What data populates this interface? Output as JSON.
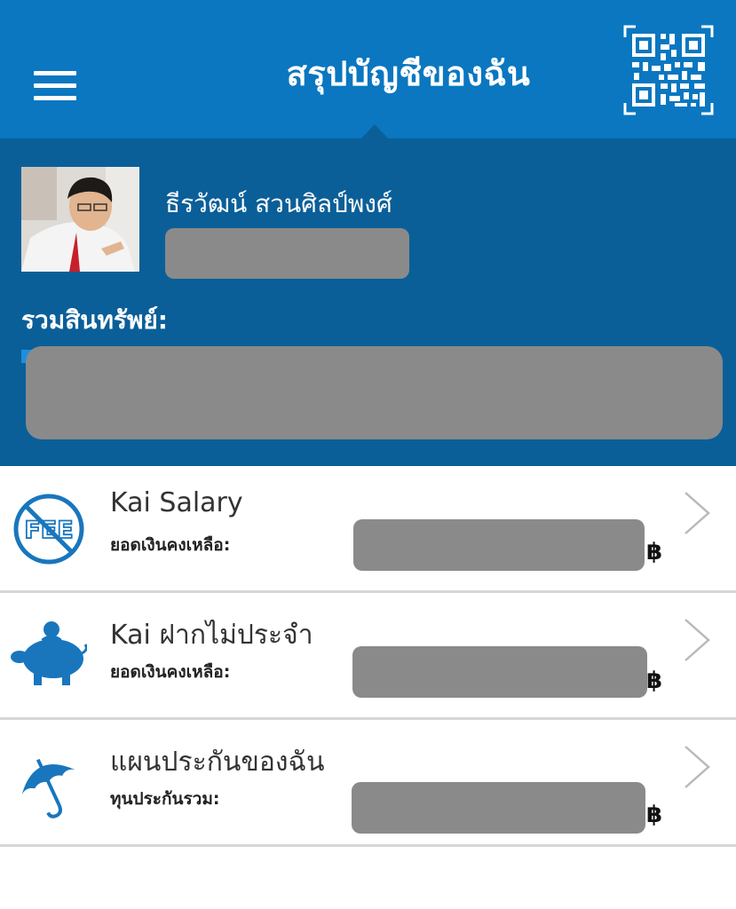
{
  "header": {
    "title": "สรุปบัญชีของฉัน",
    "menu_icon": "hamburger-menu-icon",
    "qr_icon": "qr-code-icon",
    "color": "#0a77c0"
  },
  "profile": {
    "name": "ธีรวัฒน์ สวนศิลป์พงศ์",
    "assets_label": "รวมสินทรัพย์:",
    "color": "#0b5f98"
  },
  "accounts": [
    {
      "icon": "no-fee-icon",
      "title": "Kai Salary",
      "subtitle": "ยอดเงินคงเหลือ:",
      "currency": "฿"
    },
    {
      "icon": "piggy-bank-icon",
      "title": "Kai ฝากไม่ประจำ",
      "subtitle": "ยอดเงินคงเหลือ:",
      "currency": "฿"
    },
    {
      "icon": "umbrella-icon",
      "title": "แผนประกันของฉัน",
      "subtitle": "ทุนประกันรวม:",
      "currency": "฿"
    }
  ]
}
